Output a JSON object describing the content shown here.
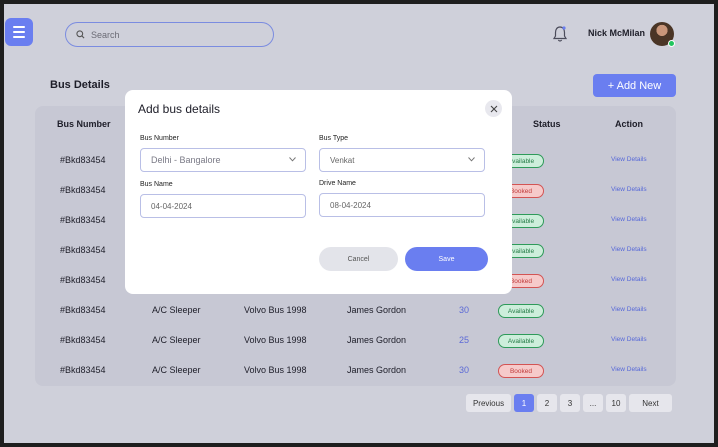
{
  "header": {
    "search_placeholder": "Search",
    "user_name": "Nick McMilan"
  },
  "page": {
    "title": "Bus Details",
    "add_new_label": "+ Add New"
  },
  "table": {
    "columns": [
      "Bus Number",
      "Status",
      "Action"
    ],
    "rows": [
      {
        "bus_number": "#Bkd83454",
        "status": "Available",
        "action": "View Details"
      },
      {
        "bus_number": "#Bkd83454",
        "status": "Booked",
        "action": "View Details"
      },
      {
        "bus_number": "#Bkd83454",
        "status": "Available",
        "action": "View Details"
      },
      {
        "bus_number": "#Bkd83454",
        "status": "Available",
        "action": "View Details"
      },
      {
        "bus_number": "#Bkd83454",
        "status": "Booked",
        "action": "View Details"
      },
      {
        "bus_number": "#Bkd83454",
        "type": "A/C Sleeper",
        "name": "Volvo Bus 1998",
        "driver": "James Gordon",
        "seats": "30",
        "status": "Available",
        "action": "View Details"
      },
      {
        "bus_number": "#Bkd83454",
        "type": "A/C Sleeper",
        "name": "Volvo Bus 1998",
        "driver": "James Gordon",
        "seats": "25",
        "status": "Available",
        "action": "View Details"
      },
      {
        "bus_number": "#Bkd83454",
        "type": "A/C Sleeper",
        "name": "Volvo Bus 1998",
        "driver": "James Gordon",
        "seats": "30",
        "status": "Booked",
        "action": "View Details"
      }
    ]
  },
  "pagination": {
    "previous": "Previous",
    "pages": [
      "1",
      "2",
      "3",
      "...",
      "10"
    ],
    "next": "Next"
  },
  "modal": {
    "title": "Add bus details",
    "bus_number_label": "Bus Number",
    "bus_number_value": "Delhi - Bangalore",
    "bus_type_label": "Bus Type",
    "bus_type_value": "Venkat",
    "bus_name_label": "Bus Name",
    "bus_name_value": "04-04-2024",
    "driver_name_label": "Drive Name",
    "driver_name_value": "08-04-2024",
    "cancel_label": "Cancel",
    "save_label": "Save"
  },
  "colors": {
    "accent": "#6a7ef0",
    "available": "#2f9a5a",
    "booked": "#d35454"
  }
}
